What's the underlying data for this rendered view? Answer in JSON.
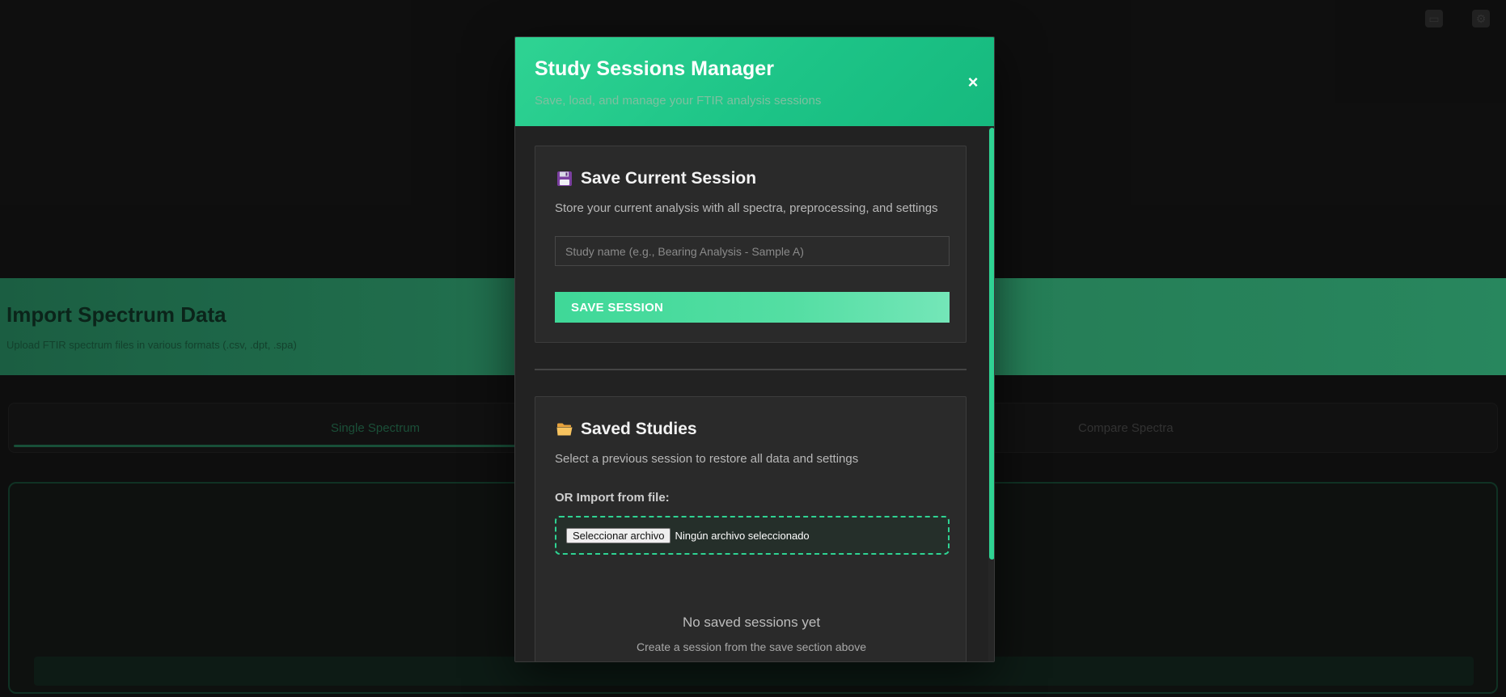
{
  "background": {
    "hero_title": "Import Spectrum Data",
    "hero_subtitle": "Upload FTIR spectrum files in various formats (.csv, .dpt, .spa)",
    "tabs": [
      {
        "label": "Single Spectrum",
        "active": true
      },
      {
        "label": "Compare Spectra",
        "active": false
      }
    ],
    "top_icons": [
      "document-icon",
      "gear-icon"
    ],
    "accent": "#2fd393"
  },
  "modal": {
    "title": "Study Sessions Manager",
    "subtitle": "Save, load, and manage your FTIR analysis sessions",
    "close_symbol": "×",
    "save_section": {
      "icon": "floppy-disk-icon",
      "title": "Save Current Session",
      "description": "Store your current analysis with all spectra, preprocessing, and settings",
      "input_placeholder": "Study name (e.g., Bearing Analysis - Sample A)",
      "input_value": "",
      "button_label": "SAVE SESSION"
    },
    "studies_section": {
      "icon": "folder-icon",
      "title": "Saved Studies",
      "description": "Select a previous session to restore all data and settings",
      "import_label": "OR Import from file:",
      "file_button_label": "Seleccionar archivo",
      "file_status": "Ningún archivo seleccionado",
      "empty_title": "No saved sessions yet",
      "empty_subtitle": "Create a session from the save section above"
    }
  },
  "colors": {
    "header_gradient_start": "#2fd393",
    "header_gradient_end": "#16b97e",
    "button_gradient_start": "#3fd898",
    "button_gradient_end": "#74e6b8",
    "modal_body": "#222222",
    "card_bg": "#2a2a2a"
  }
}
